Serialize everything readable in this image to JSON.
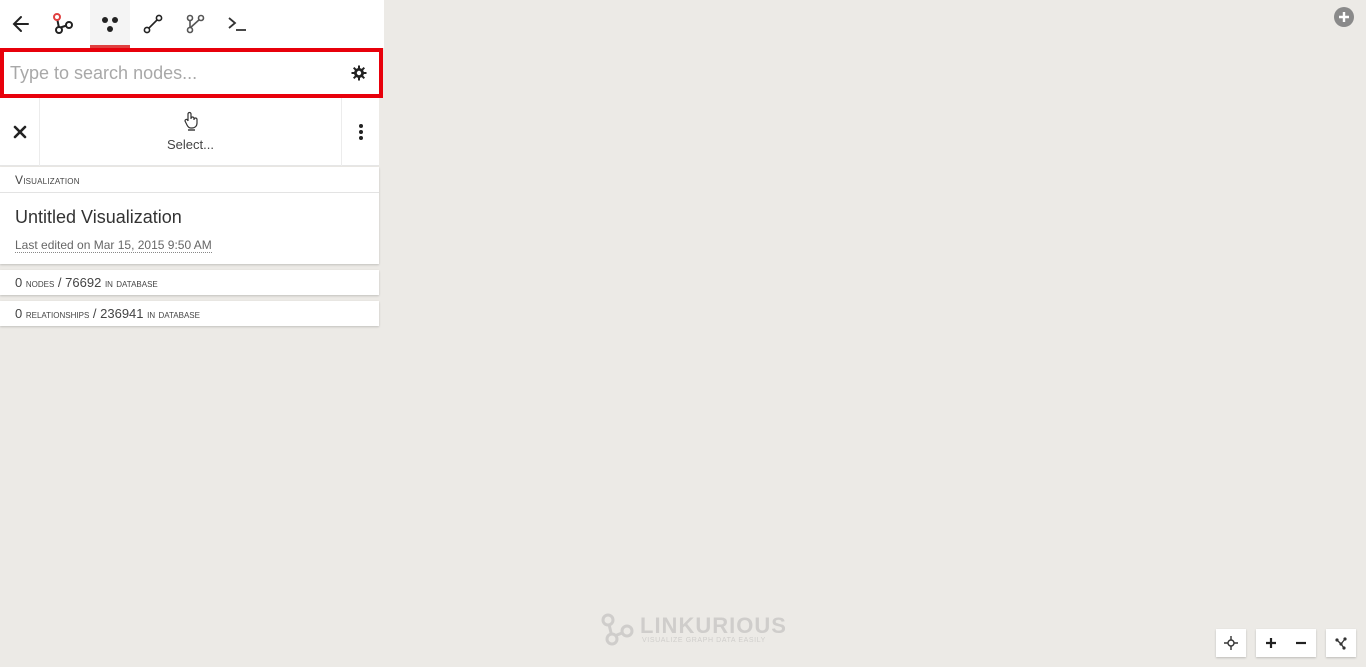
{
  "toolbar": {
    "icons": [
      "back-arrow-icon",
      "graph-logo-icon",
      "nodes-icon",
      "relationship-icon",
      "graph-branch-icon",
      "terminal-icon"
    ],
    "active_color": "#e04040"
  },
  "search": {
    "placeholder": "Type to search nodes...",
    "value": "",
    "highlight_color": "#e8000b"
  },
  "select_bar": {
    "label": "Select..."
  },
  "visualization": {
    "header": "Visualization",
    "title": "Untitled Visualization",
    "edited": "Last edited on Mar 15, 2015 9:50 AM"
  },
  "stats": {
    "nodes_count": "0",
    "nodes_label": "nodes",
    "nodes_total": "76692",
    "nodes_suffix": "in database",
    "rels_count": "0",
    "rels_label": "relationships",
    "rels_total": "236941",
    "rels_suffix": "in database"
  },
  "watermark": {
    "name": "LINKURIOUS",
    "tagline": "VISUALIZE GRAPH DATA EASILY"
  }
}
